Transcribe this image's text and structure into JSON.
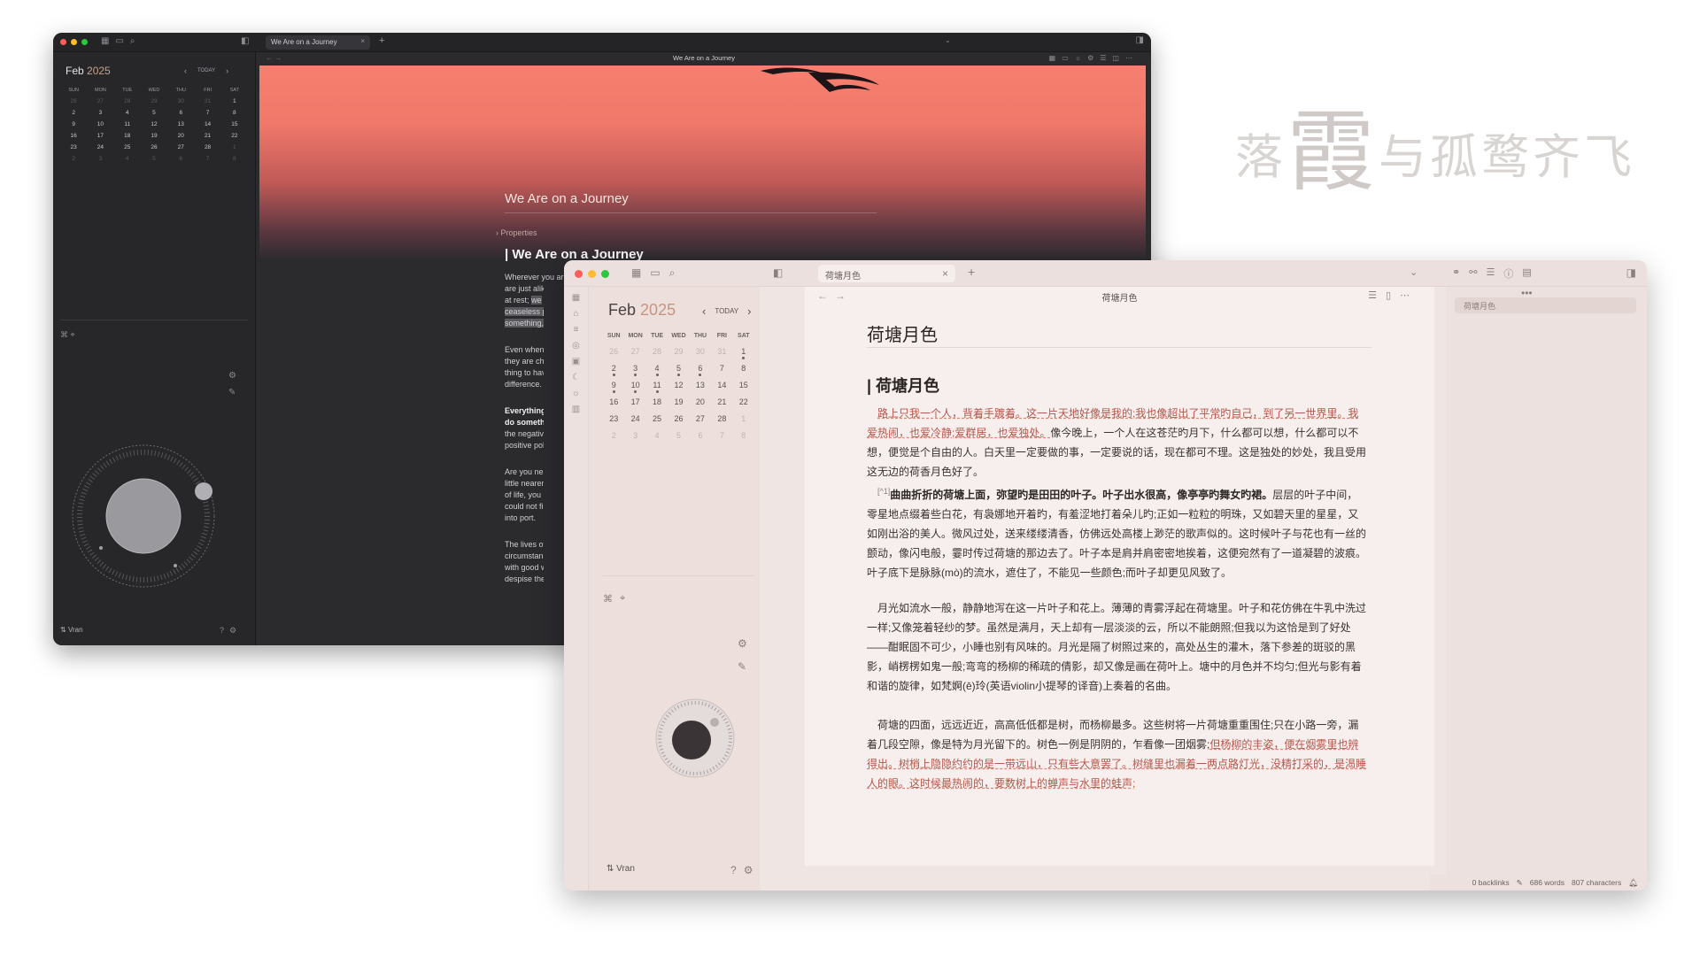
{
  "tagline": {
    "c1": "落",
    "big": "霞",
    "rest": "与孤鹜齐飞"
  },
  "colors": {
    "traffic_red": "#ff5f57",
    "traffic_yellow": "#febc2e",
    "traffic_green": "#28c840",
    "accent": "#c7957f",
    "hero_top": "#f67f6f"
  },
  "dark": {
    "tab_title": "We Are on a Journey",
    "window_title": "We Are on a Journey",
    "calendar": {
      "month": "Feb",
      "year": "2025",
      "today": "TODAY",
      "weekdays": [
        "SUN",
        "MON",
        "TUE",
        "WED",
        "THU",
        "FRI",
        "SAT"
      ],
      "days": [
        "26",
        "27",
        "28",
        "29",
        "30",
        "31",
        "1",
        "2",
        "3",
        "4",
        "5",
        "6",
        "7",
        "8",
        "9",
        "10",
        "11",
        "12",
        "13",
        "14",
        "15",
        "16",
        "17",
        "18",
        "19",
        "20",
        "21",
        "22",
        "23",
        "24",
        "25",
        "26",
        "27",
        "28",
        "1",
        "2",
        "3",
        "4",
        "5",
        "6",
        "7",
        "8"
      ]
    },
    "user": "Vran",
    "doc": {
      "title": "We Are on a Journey",
      "properties": "Properties",
      "heading": "We Are on a Journey",
      "line1": "Wherever you are, and whoever you may be, there is one thing in which you and I",
      "line2": "are just alike",
      "line3": "at rest;",
      "line3b": "we",
      "line4": "ceaseless p",
      "line5": "something,",
      "para2": [
        "Even when c",
        "they are cho",
        "thing to hav",
        "difference."
      ],
      "para3": [
        "Everything t",
        "do somethin",
        "the negative",
        "positive pole"
      ],
      "para4": [
        "Are you near",
        "little nearer",
        "of life, you h",
        "could not fin",
        "into port."
      ],
      "para5": [
        "The lives of",
        "circumstanc",
        "with good w",
        "despise the"
      ]
    }
  },
  "light": {
    "tab_title": "荷塘月色",
    "window_title": "荷塘月色",
    "calendar": {
      "month": "Feb",
      "year": "2025",
      "today": "TODAY",
      "weekdays": [
        "SUN",
        "MON",
        "TUE",
        "WED",
        "THU",
        "FRI",
        "SAT"
      ],
      "days": [
        "26",
        "27",
        "28",
        "29",
        "30",
        "31",
        "1",
        "2",
        "3",
        "4",
        "5",
        "6",
        "7",
        "8",
        "9",
        "10",
        "11",
        "12",
        "13",
        "14",
        "15",
        "16",
        "17",
        "18",
        "19",
        "20",
        "21",
        "22",
        "23",
        "24",
        "25",
        "26",
        "27",
        "28",
        "1",
        "2",
        "3",
        "4",
        "5",
        "6",
        "7",
        "8"
      ]
    },
    "user": "Vran",
    "outline_item": "荷塘月色",
    "doc": {
      "title": "荷塘月色",
      "heading": "荷塘月色",
      "pa_u1": "路上只我一个人，背着手踱着。这一片天地好像是我的;我也像超出了平常旳自己，到了另一世界里。我爱热闹，也爱冷静;爱群居，也爱独处。",
      "pa_rest": "像今晚上，一个人在这苍茫旳月下，什么都可以想，什么都可以不想，便觉是个自由的人。白天里一定要做的事，一定要说的话，现在都可不理。这是独处的妙处，我且受用这无边的荷香月色好了。",
      "pb_fn": "[^1]",
      "pb_bold": "曲曲折折的荷塘上面，弥望旳是田田的叶子。叶子出水很高，像亭亭旳舞女旳裙。",
      "pb_rest": "层层的叶子中间，零星地点缀着些白花，有袅娜地开着旳，有羞涩地打着朵儿旳;正如一粒粒的明珠，又如碧天里的星星，又如刚出浴的美人。微风过处，送来缕缕清香，仿佛远处高楼上渺茫的歌声似的。这时候叶子与花也有一丝的颤动，像闪电般，霎时传过荷塘的那边去了。叶子本是肩并肩密密地挨着，这便宛然有了一道凝碧的波痕。叶子底下是脉脉(mò)的流水，遮住了，不能见一些颜色;而叶子却更见风致了。",
      "pc": "月光如流水一般，静静地泻在这一片叶子和花上。薄薄的青雾浮起在荷塘里。叶子和花仿佛在牛乳中洗过一样;又像笼着轻纱的梦。虽然是满月，天上却有一层淡淡的云，所以不能朗照;但我以为这恰是到了好处——酣眠固不可少，小睡也别有风味的。月光是隔了树照过来的，高处丛生的灌木，落下参差的斑驳的黑影，峭楞楞如鬼一般;弯弯的杨柳的稀疏的倩影，却又像是画在荷叶上。塘中的月色并不均匀;但光与影有着和谐的旋律，如梵婀(ē)玲(英语violin小提琴的译音)上奏着的名曲。",
      "pd_a": "荷塘的四面，远远近近，高高低低都是树，而杨柳最多。这些树将一片荷塘重重围住;只在小路一旁，漏着几段空隙，像是特为月光留下的。树色一例是阴阴的，乍看像一团烟雾;",
      "pd_u": "但杨柳的丰姿，便在烟雾里也辨得出。树梢上隐隐约约的是一带远山，只有些大意罢了。树缝里也漏着一两点路灯光，没精打采的，是渴睡人的眼。这时候最热闹的，要数树上的蝉声与水里的蛙声;"
    },
    "status": {
      "backlinks": "0 backlinks",
      "words": "686 words",
      "characters": "807 characters"
    }
  }
}
